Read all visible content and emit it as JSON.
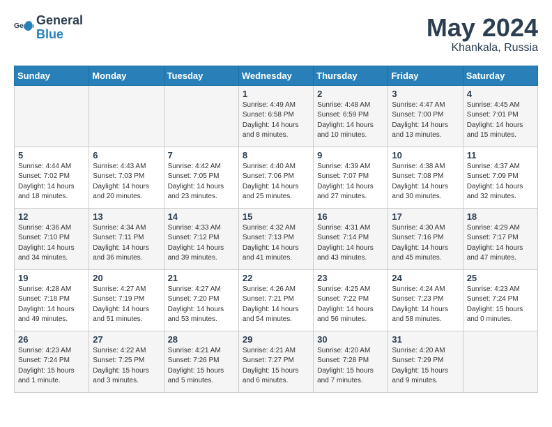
{
  "logo": {
    "text_general": "General",
    "text_blue": "Blue"
  },
  "header": {
    "month_year": "May 2024",
    "location": "Khankala, Russia"
  },
  "weekdays": [
    "Sunday",
    "Monday",
    "Tuesday",
    "Wednesday",
    "Thursday",
    "Friday",
    "Saturday"
  ],
  "weeks": [
    [
      {
        "day": "",
        "sunrise": "",
        "sunset": "",
        "daylight": ""
      },
      {
        "day": "",
        "sunrise": "",
        "sunset": "",
        "daylight": ""
      },
      {
        "day": "",
        "sunrise": "",
        "sunset": "",
        "daylight": ""
      },
      {
        "day": "1",
        "sunrise": "Sunrise: 4:49 AM",
        "sunset": "Sunset: 6:58 PM",
        "daylight": "Daylight: 14 hours and 8 minutes."
      },
      {
        "day": "2",
        "sunrise": "Sunrise: 4:48 AM",
        "sunset": "Sunset: 6:59 PM",
        "daylight": "Daylight: 14 hours and 10 minutes."
      },
      {
        "day": "3",
        "sunrise": "Sunrise: 4:47 AM",
        "sunset": "Sunset: 7:00 PM",
        "daylight": "Daylight: 14 hours and 13 minutes."
      },
      {
        "day": "4",
        "sunrise": "Sunrise: 4:45 AM",
        "sunset": "Sunset: 7:01 PM",
        "daylight": "Daylight: 14 hours and 15 minutes."
      }
    ],
    [
      {
        "day": "5",
        "sunrise": "Sunrise: 4:44 AM",
        "sunset": "Sunset: 7:02 PM",
        "daylight": "Daylight: 14 hours and 18 minutes."
      },
      {
        "day": "6",
        "sunrise": "Sunrise: 4:43 AM",
        "sunset": "Sunset: 7:03 PM",
        "daylight": "Daylight: 14 hours and 20 minutes."
      },
      {
        "day": "7",
        "sunrise": "Sunrise: 4:42 AM",
        "sunset": "Sunset: 7:05 PM",
        "daylight": "Daylight: 14 hours and 23 minutes."
      },
      {
        "day": "8",
        "sunrise": "Sunrise: 4:40 AM",
        "sunset": "Sunset: 7:06 PM",
        "daylight": "Daylight: 14 hours and 25 minutes."
      },
      {
        "day": "9",
        "sunrise": "Sunrise: 4:39 AM",
        "sunset": "Sunset: 7:07 PM",
        "daylight": "Daylight: 14 hours and 27 minutes."
      },
      {
        "day": "10",
        "sunrise": "Sunrise: 4:38 AM",
        "sunset": "Sunset: 7:08 PM",
        "daylight": "Daylight: 14 hours and 30 minutes."
      },
      {
        "day": "11",
        "sunrise": "Sunrise: 4:37 AM",
        "sunset": "Sunset: 7:09 PM",
        "daylight": "Daylight: 14 hours and 32 minutes."
      }
    ],
    [
      {
        "day": "12",
        "sunrise": "Sunrise: 4:36 AM",
        "sunset": "Sunset: 7:10 PM",
        "daylight": "Daylight: 14 hours and 34 minutes."
      },
      {
        "day": "13",
        "sunrise": "Sunrise: 4:34 AM",
        "sunset": "Sunset: 7:11 PM",
        "daylight": "Daylight: 14 hours and 36 minutes."
      },
      {
        "day": "14",
        "sunrise": "Sunrise: 4:33 AM",
        "sunset": "Sunset: 7:12 PM",
        "daylight": "Daylight: 14 hours and 39 minutes."
      },
      {
        "day": "15",
        "sunrise": "Sunrise: 4:32 AM",
        "sunset": "Sunset: 7:13 PM",
        "daylight": "Daylight: 14 hours and 41 minutes."
      },
      {
        "day": "16",
        "sunrise": "Sunrise: 4:31 AM",
        "sunset": "Sunset: 7:14 PM",
        "daylight": "Daylight: 14 hours and 43 minutes."
      },
      {
        "day": "17",
        "sunrise": "Sunrise: 4:30 AM",
        "sunset": "Sunset: 7:16 PM",
        "daylight": "Daylight: 14 hours and 45 minutes."
      },
      {
        "day": "18",
        "sunrise": "Sunrise: 4:29 AM",
        "sunset": "Sunset: 7:17 PM",
        "daylight": "Daylight: 14 hours and 47 minutes."
      }
    ],
    [
      {
        "day": "19",
        "sunrise": "Sunrise: 4:28 AM",
        "sunset": "Sunset: 7:18 PM",
        "daylight": "Daylight: 14 hours and 49 minutes."
      },
      {
        "day": "20",
        "sunrise": "Sunrise: 4:27 AM",
        "sunset": "Sunset: 7:19 PM",
        "daylight": "Daylight: 14 hours and 51 minutes."
      },
      {
        "day": "21",
        "sunrise": "Sunrise: 4:27 AM",
        "sunset": "Sunset: 7:20 PM",
        "daylight": "Daylight: 14 hours and 53 minutes."
      },
      {
        "day": "22",
        "sunrise": "Sunrise: 4:26 AM",
        "sunset": "Sunset: 7:21 PM",
        "daylight": "Daylight: 14 hours and 54 minutes."
      },
      {
        "day": "23",
        "sunrise": "Sunrise: 4:25 AM",
        "sunset": "Sunset: 7:22 PM",
        "daylight": "Daylight: 14 hours and 56 minutes."
      },
      {
        "day": "24",
        "sunrise": "Sunrise: 4:24 AM",
        "sunset": "Sunset: 7:23 PM",
        "daylight": "Daylight: 14 hours and 58 minutes."
      },
      {
        "day": "25",
        "sunrise": "Sunrise: 4:23 AM",
        "sunset": "Sunset: 7:24 PM",
        "daylight": "Daylight: 15 hours and 0 minutes."
      }
    ],
    [
      {
        "day": "26",
        "sunrise": "Sunrise: 4:23 AM",
        "sunset": "Sunset: 7:24 PM",
        "daylight": "Daylight: 15 hours and 1 minute."
      },
      {
        "day": "27",
        "sunrise": "Sunrise: 4:22 AM",
        "sunset": "Sunset: 7:25 PM",
        "daylight": "Daylight: 15 hours and 3 minutes."
      },
      {
        "day": "28",
        "sunrise": "Sunrise: 4:21 AM",
        "sunset": "Sunset: 7:26 PM",
        "daylight": "Daylight: 15 hours and 5 minutes."
      },
      {
        "day": "29",
        "sunrise": "Sunrise: 4:21 AM",
        "sunset": "Sunset: 7:27 PM",
        "daylight": "Daylight: 15 hours and 6 minutes."
      },
      {
        "day": "30",
        "sunrise": "Sunrise: 4:20 AM",
        "sunset": "Sunset: 7:28 PM",
        "daylight": "Daylight: 15 hours and 7 minutes."
      },
      {
        "day": "31",
        "sunrise": "Sunrise: 4:20 AM",
        "sunset": "Sunset: 7:29 PM",
        "daylight": "Daylight: 15 hours and 9 minutes."
      },
      {
        "day": "",
        "sunrise": "",
        "sunset": "",
        "daylight": ""
      }
    ]
  ]
}
